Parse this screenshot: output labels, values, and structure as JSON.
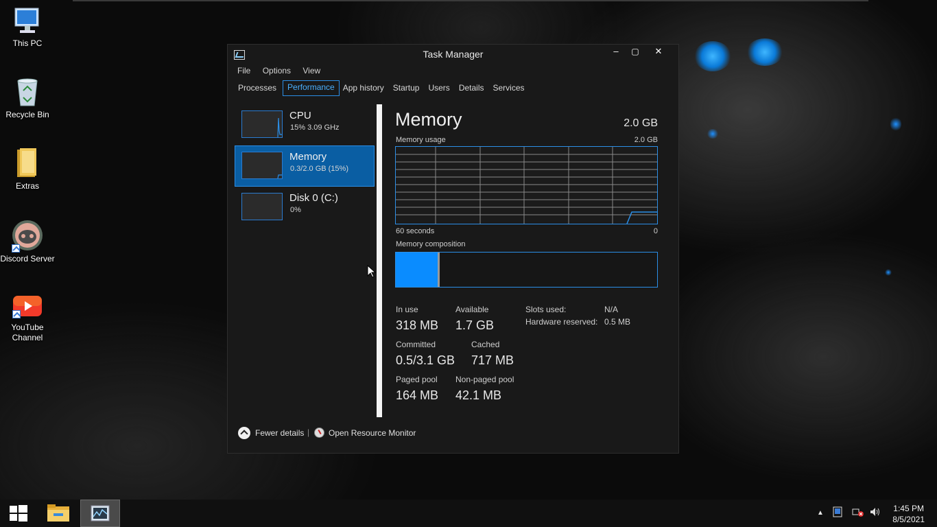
{
  "desktop": {
    "icons": [
      {
        "label": "This PC",
        "icon": "this-pc-icon"
      },
      {
        "label": "Recycle Bin",
        "icon": "recycle-bin-icon"
      },
      {
        "label": "Extras",
        "icon": "folder-icon"
      },
      {
        "label": "Discord Server",
        "icon": "discord-icon"
      },
      {
        "label": "YouTube Channel",
        "icon": "youtube-icon"
      }
    ]
  },
  "window": {
    "title": "Task Manager",
    "controls": {
      "minimize": "–",
      "maximize": "▢",
      "close": "✕"
    },
    "menu": [
      "File",
      "Options",
      "View"
    ],
    "tabs": [
      "Processes",
      "Performance",
      "App history",
      "Startup",
      "Users",
      "Details",
      "Services"
    ],
    "active_tab": "Performance"
  },
  "sidebar": {
    "items": [
      {
        "name": "CPU",
        "sub": "15% 3.09 GHz",
        "selected": false
      },
      {
        "name": "Memory",
        "sub": "0.3/2.0 GB (15%)",
        "selected": true
      },
      {
        "name": "Disk 0 (C:)",
        "sub": "0%",
        "selected": false
      }
    ]
  },
  "memory": {
    "title": "Memory",
    "total": "2.0 GB",
    "usage_label": "Memory usage",
    "usage_max": "2.0 GB",
    "time_left": "60 seconds",
    "time_right": "0",
    "composition_label": "Memory composition",
    "composition_in_use_fraction": 0.16,
    "stats": {
      "in_use_label": "In use",
      "in_use": "318 MB",
      "available_label": "Available",
      "available": "1.7 GB",
      "committed_label": "Committed",
      "committed": "0.5/3.1 GB",
      "cached_label": "Cached",
      "cached": "717 MB",
      "paged_label": "Paged pool",
      "paged": "164 MB",
      "nonpaged_label": "Non-paged pool",
      "nonpaged": "42.1 MB"
    },
    "kv": {
      "slots_label": "Slots used:",
      "slots": "N/A",
      "hw_label": "Hardware reserved:",
      "hw": "0.5 MB"
    }
  },
  "footer": {
    "fewer_details": "Fewer details",
    "separator": "|",
    "resource_monitor": "Open Resource Monitor"
  },
  "taskbar": {
    "time": "1:45 PM",
    "date": "8/5/2021"
  },
  "colors": {
    "accent": "#2b8fe8",
    "selection": "#0a5ea3",
    "composition": "#0a8cff"
  }
}
